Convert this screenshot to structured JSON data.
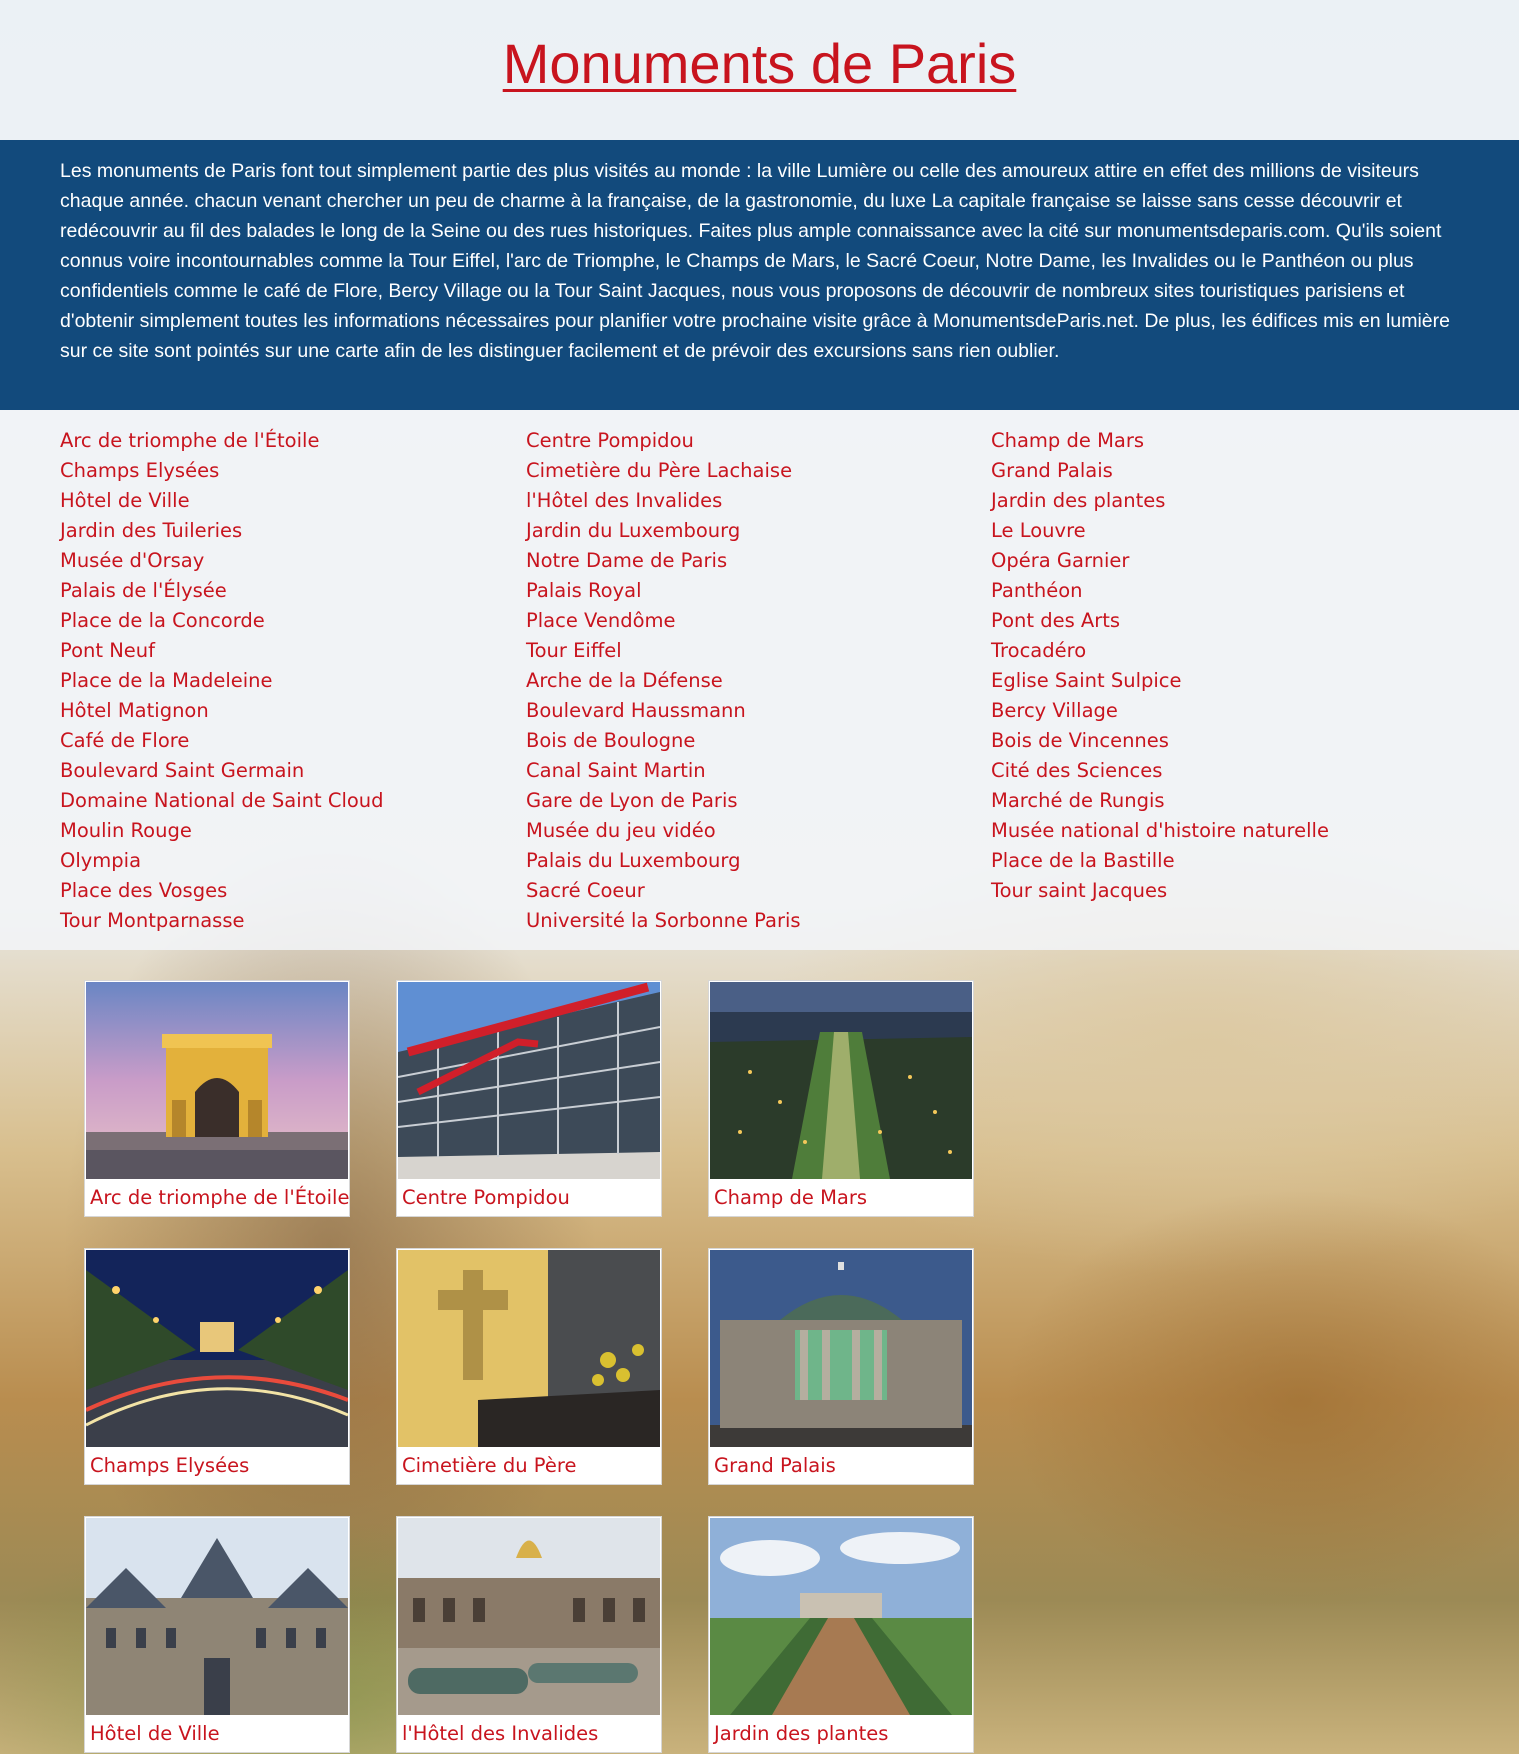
{
  "header": {
    "title": "Monuments de Paris"
  },
  "intro": {
    "text": "Les monuments de Paris font tout simplement partie des plus visités au monde : la ville Lumière ou celle des amoureux attire en effet des millions de visiteurs chaque année. chacun venant chercher un peu de charme à la française, de la gastronomie, du luxe La capitale française se laisse sans cesse découvrir et redécouvrir au fil des balades le long de la Seine ou des rues historiques. Faites plus ample connaissance avec la cité sur monumentsdeparis.com. Qu'ils soient connus voire incontournables comme la Tour Eiffel, l'arc de Triomphe, le Champs de Mars, le Sacré Coeur, Notre Dame, les Invalides ou le Panthéon ou plus confidentiels comme le café de Flore, Bercy Village ou la Tour Saint Jacques, nous vous proposons de découvrir de nombreux sites touristiques parisiens et d'obtenir simplement toutes les informations nécessaires pour planifier votre prochaine visite grâce à MonumentsdeParis.net. De plus, les édifices mis en lumière sur ce site sont pointés sur une carte afin de les distinguer facilement et de prévoir des excursions sans rien oublier."
  },
  "links": {
    "col1": [
      "Arc de triomphe de l'Étoile",
      "Champs Elysées",
      "Hôtel de Ville",
      "Jardin des Tuileries",
      "Musée d'Orsay",
      "Palais de l'Élysée",
      "Place de la Concorde",
      "Pont Neuf",
      "Place de la Madeleine",
      "Hôtel Matignon",
      "Café de Flore",
      "Boulevard Saint Germain",
      "Domaine National de Saint Cloud",
      "Moulin Rouge",
      "Olympia",
      "Place des Vosges",
      "Tour Montparnasse"
    ],
    "col2": [
      "Centre Pompidou",
      "Cimetière du Père Lachaise",
      "l'Hôtel des Invalides",
      "Jardin du Luxembourg",
      "Notre Dame de Paris",
      "Palais Royal",
      "Place Vendôme",
      "Tour Eiffel",
      "Arche de la Défense",
      "Boulevard Haussmann",
      "Bois de Boulogne",
      "Canal Saint Martin",
      "Gare de Lyon de Paris",
      "Musée du jeu vidéo",
      "Palais du Luxembourg",
      "Sacré Coeur",
      "Université la Sorbonne Paris"
    ],
    "col3": [
      "Champ de Mars",
      "Grand Palais",
      "Jardin des plantes",
      "Le Louvre",
      "Opéra Garnier",
      "Panthéon",
      "Pont des Arts",
      "Trocadéro",
      "Eglise Saint Sulpice",
      "Bercy Village",
      "Bois de Vincennes",
      "Cité des Sciences",
      "Marché de Rungis",
      "Musée national d'histoire naturelle",
      "Place de la Bastille",
      "Tour saint Jacques"
    ]
  },
  "cards": [
    "Arc de triomphe de l'Étoile",
    "Centre Pompidou",
    "Champ de Mars",
    "Champs Elysées",
    "Cimetière du Père",
    "Grand Palais",
    "Hôtel de Ville",
    "l'Hôtel des Invalides",
    "Jardin des plantes"
  ],
  "colors": {
    "link_red": "#c8141e",
    "intro_blue": "#124a7c"
  }
}
